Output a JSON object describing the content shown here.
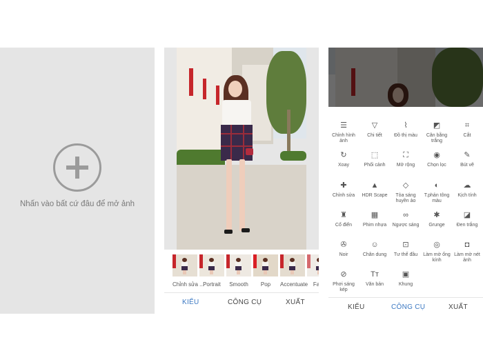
{
  "open_screen": {
    "hint": "Nhấn vào bất cứ đâu để mở ảnh"
  },
  "styles_screen": {
    "filters": [
      {
        "label": "Chỉnh sửa ..."
      },
      {
        "label": "Portrait"
      },
      {
        "label": "Smooth"
      },
      {
        "label": "Pop"
      },
      {
        "label": "Accentuate"
      },
      {
        "label": "Fade"
      }
    ],
    "tabs": [
      {
        "label": "KIỂU",
        "active": true
      },
      {
        "label": "CÔNG CỤ",
        "active": false
      },
      {
        "label": "XUẤT",
        "active": false
      }
    ]
  },
  "tools_screen": {
    "tools": [
      {
        "label": "Chỉnh hình ảnh",
        "icon": "tune-icon",
        "glyph": "☰"
      },
      {
        "label": "Chi tiết",
        "icon": "details-icon",
        "glyph": "▽"
      },
      {
        "label": "Đồ thị màu",
        "icon": "curves-icon",
        "glyph": "⌇"
      },
      {
        "label": "Cân bằng trắng",
        "icon": "white-balance-icon",
        "glyph": "◩"
      },
      {
        "label": "Cắt",
        "icon": "crop-icon",
        "glyph": "⌗"
      },
      {
        "label": "Xoay",
        "icon": "rotate-icon",
        "glyph": "↻"
      },
      {
        "label": "Phối cảnh",
        "icon": "perspective-icon",
        "glyph": "⬚"
      },
      {
        "label": "Mở rộng",
        "icon": "expand-icon",
        "glyph": "⛶"
      },
      {
        "label": "Chọn lọc",
        "icon": "selective-icon",
        "glyph": "◉"
      },
      {
        "label": "Bút vẽ",
        "icon": "brush-icon",
        "glyph": "✎"
      },
      {
        "label": "Chỉnh sửa",
        "icon": "healing-icon",
        "glyph": "✚"
      },
      {
        "label": "HDR Scape",
        "icon": "hdr-icon",
        "glyph": "▲"
      },
      {
        "label": "Tỏa sáng huyền ảo",
        "icon": "glamour-glow-icon",
        "glyph": "◇"
      },
      {
        "label": "T.phản tông màu",
        "icon": "tonal-contrast-icon",
        "glyph": "◐"
      },
      {
        "label": "Kịch tính",
        "icon": "drama-icon",
        "glyph": "☁"
      },
      {
        "label": "Cổ điển",
        "icon": "vintage-icon",
        "glyph": "♜"
      },
      {
        "label": "Phim nhựa",
        "icon": "grainy-film-icon",
        "glyph": "▦"
      },
      {
        "label": "Ngược sáng",
        "icon": "retrolux-icon",
        "glyph": "∞"
      },
      {
        "label": "Grunge",
        "icon": "grunge-icon",
        "glyph": "✱"
      },
      {
        "label": "Đen trắng",
        "icon": "black-white-icon",
        "glyph": "◪"
      },
      {
        "label": "Noir",
        "icon": "noir-icon",
        "glyph": "✇"
      },
      {
        "label": "Chân dung",
        "icon": "portrait-icon",
        "glyph": "☺"
      },
      {
        "label": "Tư thế đầu",
        "icon": "head-pose-icon",
        "glyph": "⊡"
      },
      {
        "label": "Làm mờ ống kính",
        "icon": "lens-blur-icon",
        "glyph": "◎"
      },
      {
        "label": "Làm mờ nét ảnh",
        "icon": "vignette-icon",
        "glyph": "◘"
      },
      {
        "label": "Phơi sáng kép",
        "icon": "double-exposure-icon",
        "glyph": "⊘"
      },
      {
        "label": "Văn bản",
        "icon": "text-icon",
        "glyph": "Tт"
      },
      {
        "label": "Khung",
        "icon": "frame-icon",
        "glyph": "▣"
      }
    ],
    "tabs": [
      {
        "label": "KIỂU",
        "active": false
      },
      {
        "label": "CÔNG CỤ",
        "active": true
      },
      {
        "label": "XUẤT",
        "active": false
      }
    ]
  },
  "colors": {
    "accent": "#3b78c2",
    "panel_gray": "#e5e5e5",
    "text_gray": "#7a7a7a"
  }
}
